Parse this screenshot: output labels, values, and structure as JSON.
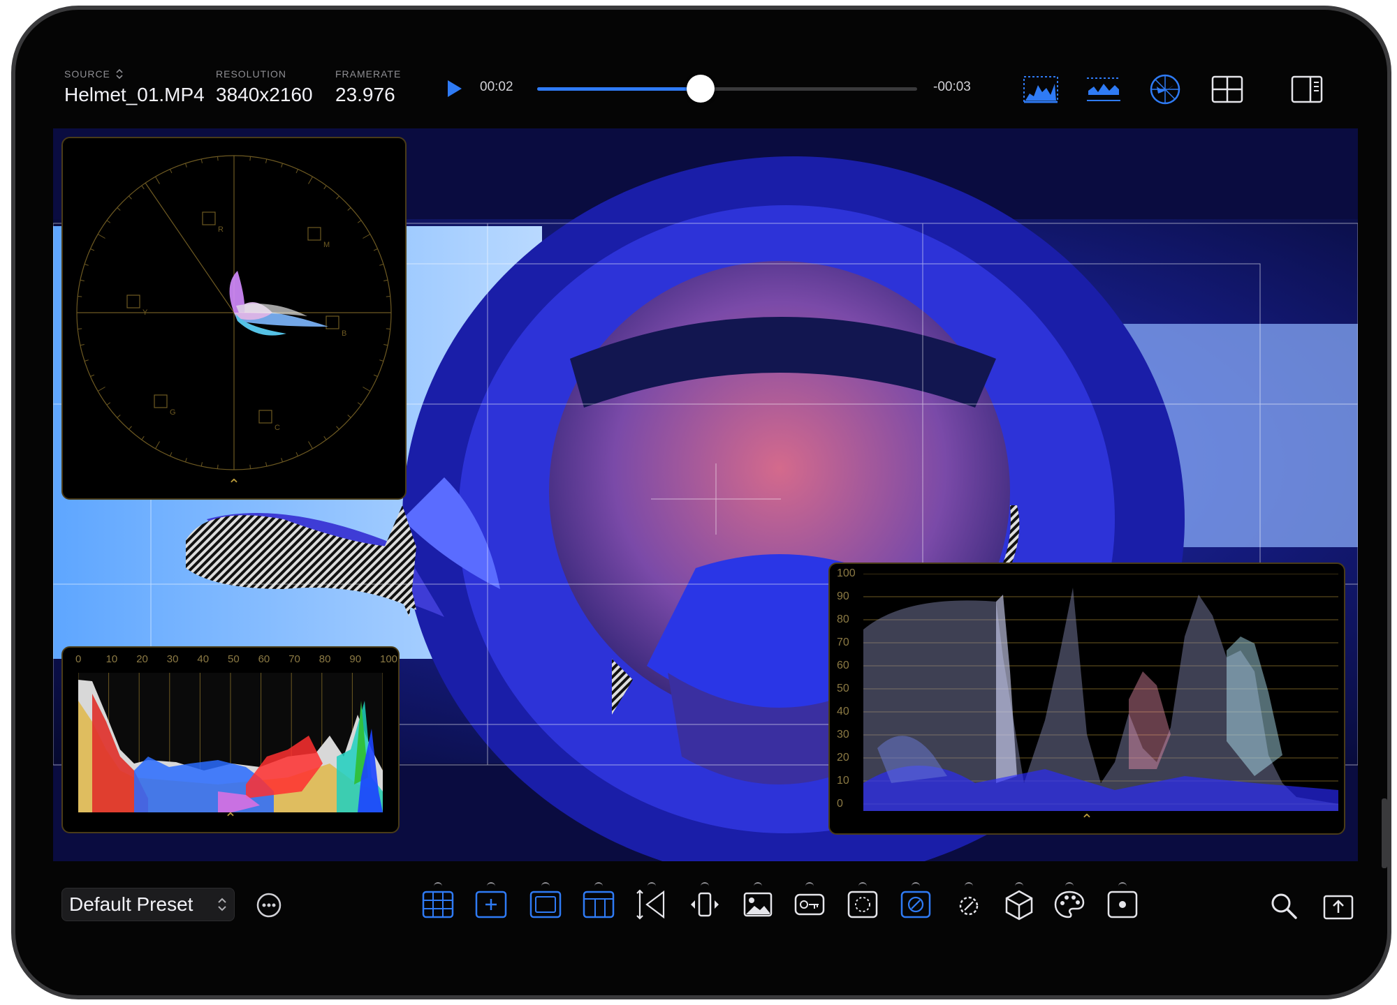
{
  "header": {
    "source_label": "SOURCE",
    "source_value": "Helmet_01.MP4",
    "resolution_label": "RESOLUTION",
    "resolution_value": "3840x2160",
    "framerate_label": "FRAMERATE",
    "framerate_value": "23.976"
  },
  "playback": {
    "elapsed": "00:02",
    "remaining": "-00:03",
    "progress": 0.43
  },
  "histogram": {
    "ticks": [
      "0",
      "10",
      "20",
      "30",
      "40",
      "50",
      "60",
      "70",
      "80",
      "90",
      "100"
    ]
  },
  "waveform": {
    "ticks": [
      "100",
      "90",
      "80",
      "70",
      "60",
      "50",
      "40",
      "30",
      "20",
      "10",
      "0"
    ]
  },
  "vectorscope": {
    "targets": [
      "R",
      "M",
      "Y",
      "B",
      "G",
      "C"
    ]
  },
  "footer": {
    "preset": "Default Preset"
  },
  "colors": {
    "accent": "#2f7bf5",
    "scope_grid": "#8c7a44",
    "background": "#050505"
  }
}
